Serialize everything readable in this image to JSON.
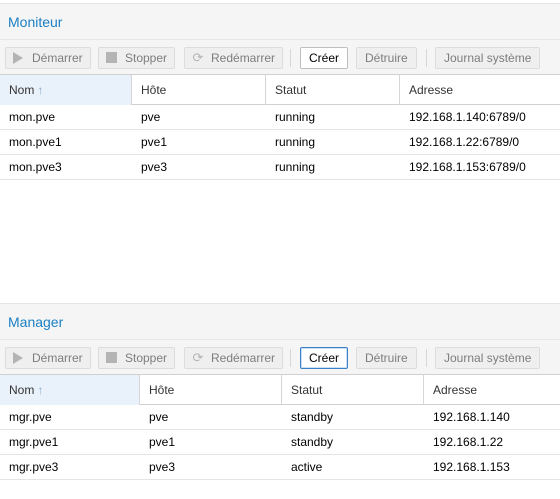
{
  "monitor": {
    "title": "Moniteur",
    "toolbar": {
      "start": "Démarrer",
      "stop": "Stopper",
      "restart": "Redémarrer",
      "create": "Créer",
      "destroy": "Détruire",
      "syslog": "Journal système"
    },
    "columns": [
      "Nom",
      "Hôte",
      "Statut",
      "Adresse"
    ],
    "sort_icon": "↑",
    "rows": [
      [
        "mon.pve",
        "pve",
        "running",
        "192.168.1.140:6789/0"
      ],
      [
        "mon.pve1",
        "pve1",
        "running",
        "192.168.1.22:6789/0"
      ],
      [
        "mon.pve3",
        "pve3",
        "running",
        "192.168.1.153:6789/0"
      ]
    ]
  },
  "manager": {
    "title": "Manager",
    "toolbar": {
      "start": "Démarrer",
      "stop": "Stopper",
      "restart": "Redémarrer",
      "create": "Créer",
      "destroy": "Détruire",
      "syslog": "Journal système"
    },
    "columns": [
      "Nom",
      "Hôte",
      "Statut",
      "Adresse"
    ],
    "sort_icon": "↑",
    "rows": [
      [
        "mgr.pve",
        "pve",
        "standby",
        "192.168.1.140"
      ],
      [
        "mgr.pve1",
        "pve1",
        "standby",
        "192.168.1.22"
      ],
      [
        "mgr.pve3",
        "pve3",
        "active",
        "192.168.1.153"
      ]
    ]
  },
  "colors": {
    "title_blue": "#1a7fc4",
    "panel_bg": "#f5f5f5",
    "sorted_header_bg": "#e9f2fa"
  }
}
